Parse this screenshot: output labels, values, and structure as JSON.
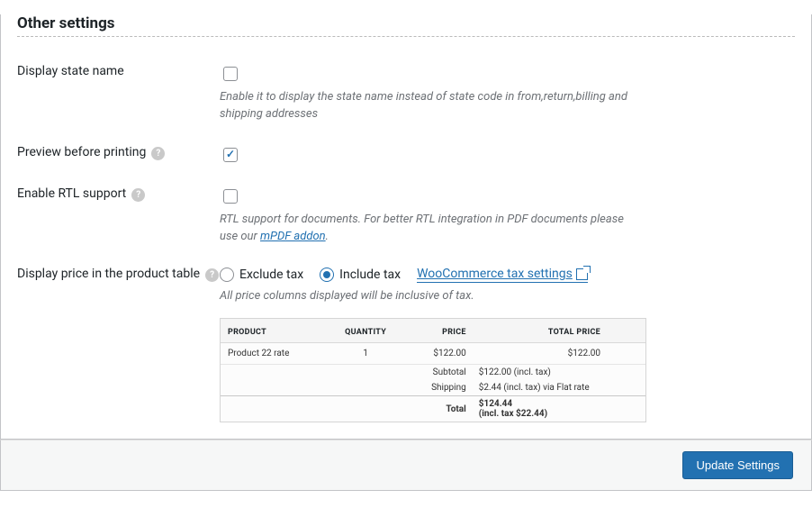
{
  "section_title": "Other settings",
  "rows": {
    "display_state_name": {
      "label": "Display state name",
      "desc": "Enable it to display the state name instead of state code in from,return,billing and shipping addresses",
      "checked": false
    },
    "preview_before_printing": {
      "label": "Preview before printing",
      "checked": true
    },
    "enable_rtl": {
      "label": "Enable RTL support",
      "desc_pre": "RTL support for documents. For better RTL integration in PDF documents please use our ",
      "link_text": "mPDF addon",
      "desc_post": ".",
      "checked": false
    },
    "display_price": {
      "label": "Display price in the product table",
      "exclude_label": "Exclude tax",
      "include_label": "Include tax",
      "selected": "include",
      "settings_link_text": "WooCommerce tax settings",
      "desc": "All price columns displayed will be inclusive of tax."
    }
  },
  "preview": {
    "headers": {
      "product": "PRODUCT",
      "quantity": "QUANTITY",
      "price": "PRICE",
      "total": "TOTAL PRICE"
    },
    "row": {
      "product": "Product 22 rate",
      "quantity": "1",
      "price": "$122.00",
      "total": "$122.00"
    },
    "subtotal": {
      "k": "Subtotal",
      "v": "$122.00 (incl. tax)"
    },
    "shipping": {
      "k": "Shipping",
      "v": "$2.44 (incl. tax) via Flat rate"
    },
    "total": {
      "k": "Total",
      "v1": "$124.44",
      "v2": "(incl. tax $22.44)"
    }
  },
  "footer": {
    "submit_label": "Update Settings"
  }
}
